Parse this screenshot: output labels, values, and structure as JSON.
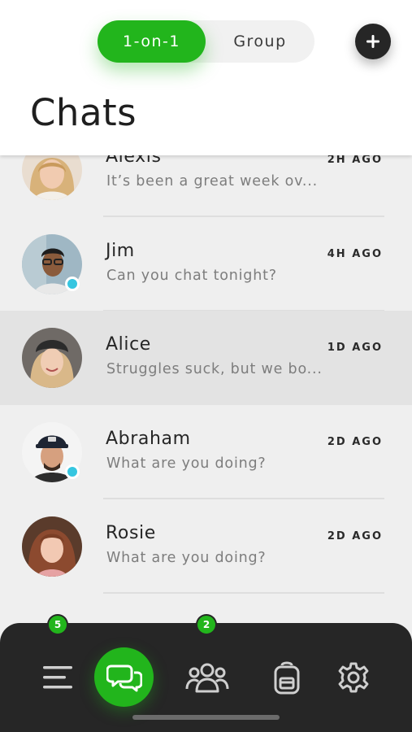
{
  "header": {
    "title": "Chats",
    "tabs": [
      {
        "label": "1-on-1",
        "active": true
      },
      {
        "label": "Group",
        "active": false
      }
    ],
    "add_icon": "plus-icon"
  },
  "chats": [
    {
      "name": "Alexis",
      "message": "It’s been a great week ov...",
      "time": "2H AGO",
      "online": false
    },
    {
      "name": "Jim",
      "message": "Can you chat tonight?",
      "time": "4H AGO",
      "online": true
    },
    {
      "name": "Alice",
      "message": "Struggles suck, but we bo...",
      "time": "1D AGO",
      "online": false,
      "highlighted": true
    },
    {
      "name": "Abraham",
      "message": "What are you doing?",
      "time": "2D AGO",
      "online": true
    },
    {
      "name": "Rosie",
      "message": "What are you doing?",
      "time": "2D AGO",
      "online": false
    }
  ],
  "nav": {
    "items": [
      {
        "icon": "menu-icon",
        "badge": "5"
      },
      {
        "icon": "chat-bubbles-icon",
        "active": true
      },
      {
        "icon": "people-icon",
        "badge": "2"
      },
      {
        "icon": "backpack-icon"
      },
      {
        "icon": "gear-icon"
      }
    ]
  },
  "colors": {
    "accent": "#22b51c",
    "online": "#36c6e0",
    "nav_bg": "#262626",
    "list_bg": "#efefef",
    "highlight_bg": "#e3e3e3"
  }
}
